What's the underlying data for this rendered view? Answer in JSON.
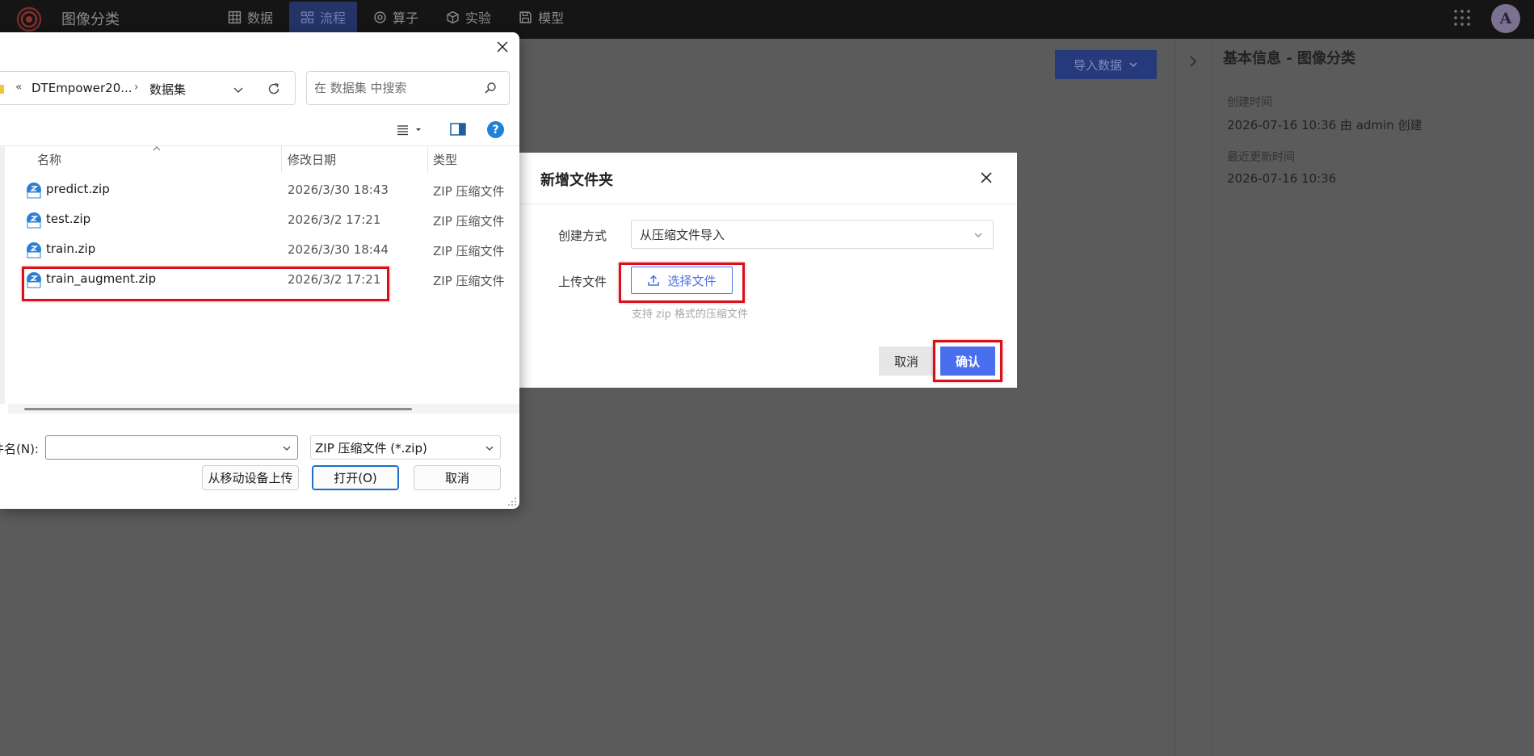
{
  "topbar": {
    "app_title": "图像分类",
    "nav": [
      {
        "label": "数据",
        "icon": "table-icon",
        "active": false
      },
      {
        "label": "流程",
        "icon": "flow-icon",
        "active": true
      },
      {
        "label": "算子",
        "icon": "operator-icon",
        "active": false
      },
      {
        "label": "实验",
        "icon": "cube-icon",
        "active": false
      },
      {
        "label": "模型",
        "icon": "save-icon",
        "active": false
      }
    ],
    "avatar_letter": "A"
  },
  "main": {
    "import_button": "导入数据"
  },
  "info_panel": {
    "title": "基本信息 - 图像分类",
    "created_label": "创建时间",
    "created_value": "2026-07-16 10:36  由 admin 创建",
    "updated_label": "最近更新时间",
    "updated_value": "2026-07-16 10:36"
  },
  "modal": {
    "title": "新增文件夹",
    "method_label": "创建方式",
    "method_value": "从压缩文件导入",
    "upload_label": "上传文件",
    "upload_button": "选择文件",
    "hint": "支持 zip 格式的压缩文件",
    "cancel": "取消",
    "confirm": "确认"
  },
  "file_dialog": {
    "breadcrumb_back": "«",
    "breadcrumb": [
      "DTEmpower20...",
      "数据集"
    ],
    "breadcrumb_sep": "›",
    "search_placeholder": "在 数据集 中搜索",
    "columns": {
      "name": "名称",
      "date": "修改日期",
      "type": "类型"
    },
    "files": [
      {
        "name": "predict.zip",
        "date": "2026/3/30 18:43",
        "type": "ZIP 压缩文件"
      },
      {
        "name": "test.zip",
        "date": "2026/3/2 17:21",
        "type": "ZIP 压缩文件"
      },
      {
        "name": "train.zip",
        "date": "2026/3/30 18:44",
        "type": "ZIP 压缩文件"
      },
      {
        "name": "train_augment.zip",
        "date": "2026/3/2 17:21",
        "type": "ZIP 压缩文件"
      }
    ],
    "filename_label": "件名(N):",
    "filename_value": "",
    "filetype_value": "ZIP 压缩文件 (*.zip)",
    "mobile_upload": "从移动设备上传",
    "open": "打开(O)",
    "cancel": "取消",
    "help": "?"
  },
  "colors": {
    "accent": "#4a6fee",
    "highlight": "#d9101c",
    "topbar": "#151515"
  }
}
